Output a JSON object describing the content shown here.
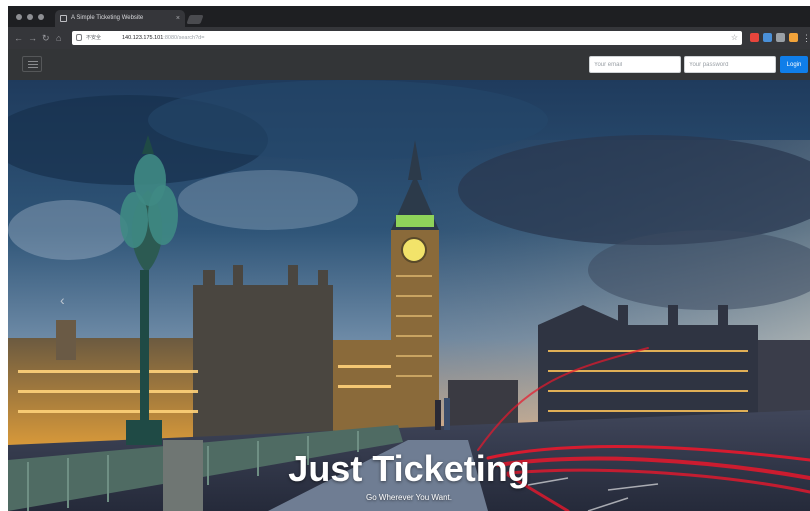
{
  "browser": {
    "tab_title": "A Simple Ticketing Website",
    "tab_close": "×",
    "url_security": "不安全",
    "url_host": "140.123.175.101",
    "url_path": ":8080/search?d=",
    "menu": "⋮"
  },
  "navbar": {
    "email_placeholder": "Your email",
    "password_placeholder": "Your password",
    "login_label": "Login"
  },
  "hero": {
    "title": "Just Ticketing",
    "subtitle": "Go Wherever You Want.",
    "prev_arrow": "‹"
  },
  "colors": {
    "navbar_bg": "#333537",
    "login_button": "#0f7ee9",
    "sky_top": "#1f3b5d",
    "light_trails": "#e8182c"
  }
}
